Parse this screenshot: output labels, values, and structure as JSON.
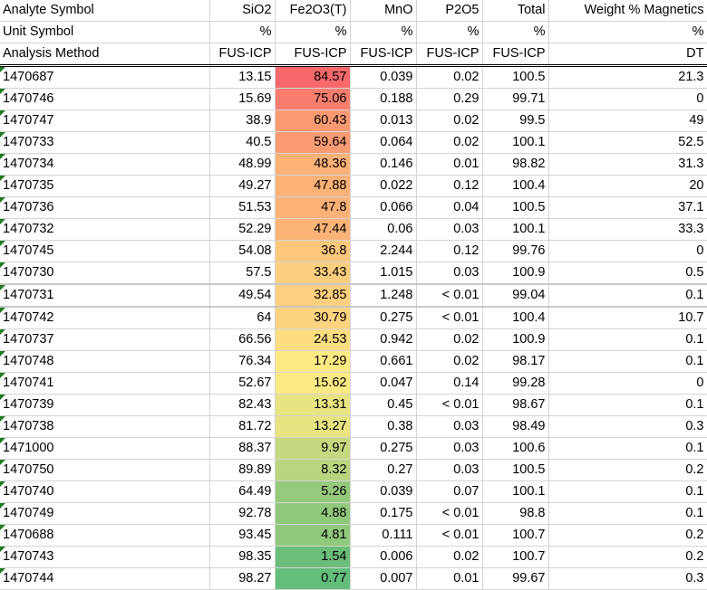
{
  "header_rows": [
    {
      "label": "Analyte Symbol",
      "cells": [
        "SiO2",
        "Fe2O3(T)",
        "MnO",
        "P2O5",
        "Total",
        "Weight % Magnetics"
      ]
    },
    {
      "label": "Unit Symbol",
      "cells": [
        "%",
        "%",
        "%",
        "%",
        "%",
        "%"
      ]
    },
    {
      "label": "Analysis Method",
      "cells": [
        "FUS-ICP",
        "FUS-ICP",
        "FUS-ICP",
        "FUS-ICP",
        "FUS-ICP",
        "DT"
      ]
    }
  ],
  "rows": [
    {
      "id": "1470687",
      "values": [
        "13.15",
        "84.57",
        "0.039",
        "0.02",
        "100.5",
        "21.3"
      ],
      "fe_color": "#f8696b"
    },
    {
      "id": "1470746",
      "values": [
        "15.69",
        "75.06",
        "0.188",
        "0.29",
        "99.71",
        "0"
      ],
      "fe_color": "#f97d6e"
    },
    {
      "id": "1470747",
      "values": [
        "38.9",
        "60.43",
        "0.013",
        "0.02",
        "99.5",
        "49"
      ],
      "fe_color": "#fb9a72"
    },
    {
      "id": "1470733",
      "values": [
        "40.5",
        "59.64",
        "0.064",
        "0.02",
        "100.1",
        "52.5"
      ],
      "fe_color": "#fb9b72"
    },
    {
      "id": "1470734",
      "values": [
        "48.99",
        "48.36",
        "0.146",
        "0.01",
        "98.82",
        "31.3"
      ],
      "fe_color": "#fcb176"
    },
    {
      "id": "1470735",
      "values": [
        "49.27",
        "47.88",
        "0.022",
        "0.12",
        "100.4",
        "20"
      ],
      "fe_color": "#fcb276"
    },
    {
      "id": "1470736",
      "values": [
        "51.53",
        "47.8",
        "0.066",
        "0.04",
        "100.5",
        "37.1"
      ],
      "fe_color": "#fcb276"
    },
    {
      "id": "1470732",
      "values": [
        "52.29",
        "47.44",
        "0.06",
        "0.03",
        "100.1",
        "33.3"
      ],
      "fe_color": "#fcb376"
    },
    {
      "id": "1470745",
      "values": [
        "54.08",
        "36.8",
        "2.244",
        "0.12",
        "99.76",
        "0"
      ],
      "fe_color": "#fdc87c"
    },
    {
      "id": "1470730",
      "values": [
        "57.5",
        "33.43",
        "1.015",
        "0.03",
        "100.9",
        "0.5"
      ],
      "fe_color": "#fdce7d"
    },
    {
      "id": "1470731",
      "values": [
        "49.54",
        "32.85",
        "1.248",
        "< 0.01",
        "99.04",
        "0.1"
      ],
      "fe_color": "#fdcf7e"
    },
    {
      "id": "1470742",
      "values": [
        "64",
        "30.79",
        "0.275",
        "< 0.01",
        "100.4",
        "10.7"
      ],
      "fe_color": "#fed37f"
    },
    {
      "id": "1470737",
      "values": [
        "66.56",
        "24.53",
        "0.942",
        "0.02",
        "100.9",
        "0.1"
      ],
      "fe_color": "#fedd81"
    },
    {
      "id": "1470748",
      "values": [
        "76.34",
        "17.29",
        "0.661",
        "0.02",
        "98.17",
        "0.1"
      ],
      "fe_color": "#feea83"
    },
    {
      "id": "1470741",
      "values": [
        "52.67",
        "15.62",
        "0.047",
        "0.14",
        "99.28",
        "0"
      ],
      "fe_color": "#fbe983"
    },
    {
      "id": "1470739",
      "values": [
        "82.43",
        "13.31",
        "0.45",
        "< 0.01",
        "98.67",
        "0.1"
      ],
      "fe_color": "#e8e482"
    },
    {
      "id": "1470738",
      "values": [
        "81.72",
        "13.27",
        "0.38",
        "0.03",
        "98.49",
        "0.3"
      ],
      "fe_color": "#e8e482"
    },
    {
      "id": "1471000",
      "values": [
        "88.37",
        "9.97",
        "0.275",
        "0.03",
        "100.6",
        "0.1"
      ],
      "fe_color": "#c6d980"
    },
    {
      "id": "1470750",
      "values": [
        "89.89",
        "8.32",
        "0.27",
        "0.03",
        "100.5",
        "0.2"
      ],
      "fe_color": "#b9d57f"
    },
    {
      "id": "1470740",
      "values": [
        "64.49",
        "5.26",
        "0.039",
        "0.07",
        "100.1",
        "0.1"
      ],
      "fe_color": "#95ca7c"
    },
    {
      "id": "1470749",
      "values": [
        "92.78",
        "4.88",
        "0.175",
        "< 0.01",
        "98.8",
        "0.1"
      ],
      "fe_color": "#91c97c"
    },
    {
      "id": "1470688",
      "values": [
        "93.45",
        "4.81",
        "0.111",
        "< 0.01",
        "100.7",
        "0.2"
      ],
      "fe_color": "#91c97c"
    },
    {
      "id": "1470743",
      "values": [
        "98.35",
        "1.54",
        "0.006",
        "0.02",
        "100.7",
        "0.2"
      ],
      "fe_color": "#6bbe7a"
    },
    {
      "id": "1470744",
      "values": [
        "98.27",
        "0.77",
        "0.007",
        "0.01",
        "99.67",
        "0.3"
      ],
      "fe_color": "#63be7b"
    }
  ],
  "thick_border_after_ids": [
    "1470730",
    "1470731"
  ],
  "colors": {
    "grid": "#d4d4d4",
    "error_indicator": "#1e7b22",
    "scale_high": "#f8696b",
    "scale_mid": "#ffeb84",
    "scale_low": "#63be7b"
  }
}
